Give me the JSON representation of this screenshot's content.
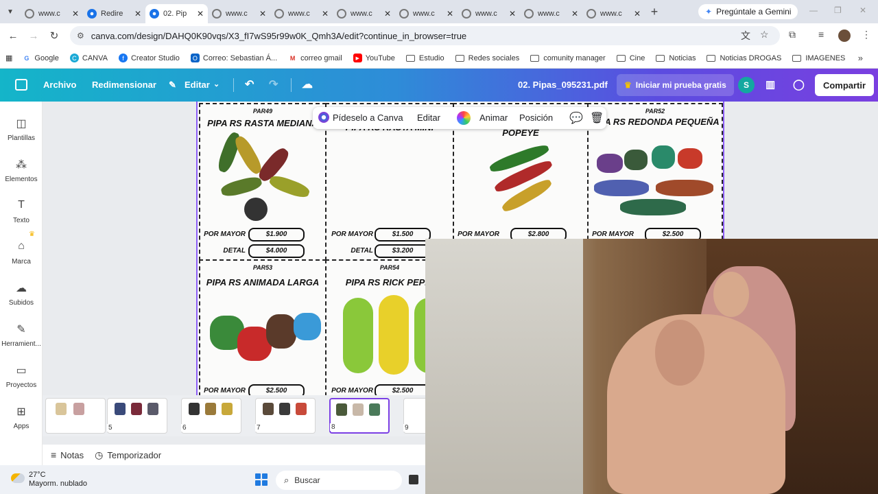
{
  "browser": {
    "tabs": [
      {
        "label": "www.c"
      },
      {
        "label": "Redire"
      },
      {
        "label": "02. Pip",
        "active": true
      },
      {
        "label": "www.c"
      },
      {
        "label": "www.c"
      },
      {
        "label": "www.c"
      },
      {
        "label": "www.c"
      },
      {
        "label": "www.c"
      },
      {
        "label": "www.c"
      },
      {
        "label": "www.c"
      }
    ],
    "gemini_label": "Pregúntale a Gemini",
    "url": "canva.com/design/DAHQ0K90vqs/X3_fI7wS95r99w0K_Qmh3A/edit?continue_in_browser=true",
    "bookmarks": [
      {
        "label": "Google",
        "icon": "google-icon"
      },
      {
        "label": "CANVA",
        "icon": "canva-icon"
      },
      {
        "label": "Creator Studio",
        "icon": "facebook-icon"
      },
      {
        "label": "Correo: Sebastian Á...",
        "icon": "outlook-icon"
      },
      {
        "label": "correo gmail",
        "icon": "gmail-icon"
      },
      {
        "label": "YouTube",
        "icon": "youtube-icon"
      },
      {
        "label": "Estudio",
        "icon": "folder-icon"
      },
      {
        "label": "Redes sociales",
        "icon": "folder-icon"
      },
      {
        "label": "comunity manager",
        "icon": "folder-icon"
      },
      {
        "label": "Cine",
        "icon": "folder-icon"
      },
      {
        "label": "Noticias",
        "icon": "folder-icon"
      },
      {
        "label": "Noticias DROGAS",
        "icon": "folder-icon"
      },
      {
        "label": "IMAGENES",
        "icon": "folder-icon"
      }
    ]
  },
  "canva": {
    "menu_file": "Archivo",
    "menu_resize": "Redimensionar",
    "menu_edit": "Editar",
    "doc_title": "02. Pipas_095231.pdf",
    "trial_label": "Iniciar mi prueba gratis",
    "user_initial": "S",
    "share_label": "Compartir",
    "sidebar": [
      {
        "label": "Plantillas"
      },
      {
        "label": "Elementos"
      },
      {
        "label": "Texto"
      },
      {
        "label": "Marca"
      },
      {
        "label": "Subidos"
      },
      {
        "label": "Herramient..."
      },
      {
        "label": "Proyectos"
      },
      {
        "label": "Apps"
      }
    ],
    "context_bar": {
      "ask": "Pídeselo a Canva",
      "edit": "Editar",
      "animate": "Animar",
      "position": "Posición"
    },
    "products": [
      {
        "code": "PAR49",
        "name": "PIPA RS RASTA MEDIANA",
        "mayor_label": "POR MAYOR",
        "mayor": "$1.900",
        "detal_label": "DETAL",
        "detal": "$4.000"
      },
      {
        "code": "",
        "name": "PIPA RS RASTA MINI",
        "mayor_label": "POR MAYOR",
        "mayor": "$1.500",
        "detal_label": "DETAL",
        "detal": "$3.200"
      },
      {
        "code": "",
        "name": "POPEYE",
        "mayor_label": "POR MAYOR",
        "mayor": "$2.800"
      },
      {
        "code": "PAR52",
        "name": "PIPA RS REDONDA PEQUEÑA",
        "mayor_label": "POR MAYOR",
        "mayor": "$2.500"
      },
      {
        "code": "PAR53",
        "name": "PIPA RS ANIMADA LARGA",
        "mayor_label": "POR MAYOR",
        "mayor": "$2.500"
      },
      {
        "code": "PAR54",
        "name": "PIPA RS RICK PEPIN",
        "mayor_label": "POR MAYOR",
        "mayor": "$2.500"
      }
    ],
    "pages": [
      {
        "num": ""
      },
      {
        "num": "5"
      },
      {
        "num": "6"
      },
      {
        "num": "7"
      },
      {
        "num": "8",
        "active": true
      },
      {
        "num": "9"
      }
    ],
    "notes_label": "Notas",
    "timer_label": "Temporizador"
  },
  "taskbar": {
    "temp": "27°C",
    "weather": "Mayorm. nublado",
    "search": "Buscar"
  }
}
